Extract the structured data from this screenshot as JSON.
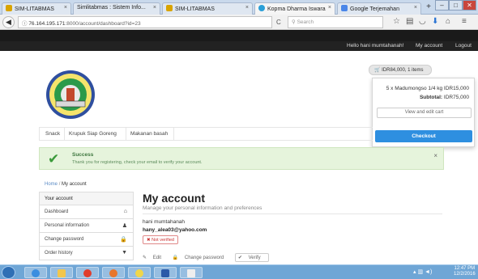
{
  "browser": {
    "tabs": [
      {
        "label": "SIM-LITABMAS",
        "active": false
      },
      {
        "label": "Simlitabmas : Sistem Info...",
        "active": false
      },
      {
        "label": "SIM-LITABMAS",
        "active": false
      },
      {
        "label": "Kopma Dharma Iswara",
        "active": true
      },
      {
        "label": "Google Terjemahan",
        "active": false
      }
    ],
    "url_domain": "76.164.195.171",
    "url_path": ":8000/account/dashboard?id=23",
    "search_placeholder": "Search",
    "close_glyph": "×",
    "newtab_glyph": "+",
    "win_min": "–",
    "win_max": "□",
    "win_close": "✕"
  },
  "header": {
    "greeting": "Hello hani mumtahanah!",
    "my_account": "My account",
    "logout": "Logout"
  },
  "cart": {
    "summary": "IDR84,000, 1 items",
    "line_item": "5 x Madumongso 1/4 kg IDR15,000",
    "subtotal_label": "Subtotal:",
    "subtotal_value": "IDR75,000",
    "view_edit": "View and edit cart",
    "checkout": "Checkout"
  },
  "categories": [
    "Snack",
    "Krupuk Siap Goreng",
    "Makanan basah"
  ],
  "alert": {
    "title": "Success",
    "message": "Thank you for registering, check your email to verify your account.",
    "close": "×"
  },
  "breadcrumb": {
    "home": "Home",
    "separator": "/",
    "current": "My account"
  },
  "sidebar": {
    "items": [
      {
        "label": "Your account",
        "icon": ""
      },
      {
        "label": "Dashboard",
        "icon": "home-icon"
      },
      {
        "label": "Personal information",
        "icon": "user-icon"
      },
      {
        "label": "Change password",
        "icon": "lock-icon"
      },
      {
        "label": "Order history",
        "icon": "filter-icon"
      }
    ]
  },
  "main": {
    "title": "My account",
    "subtitle": "Manage your personal information and preferences",
    "name": "hani mumtahanah",
    "email": "hany_alea03@yahoo.com",
    "status_badge": "Not verified",
    "edit": "Edit",
    "change_password": "Change password",
    "verify": "Verify"
  },
  "taskbar": {
    "time": "12:47 PM",
    "date": "12/2/2016"
  },
  "colors": {
    "accent": "#2e8fe0",
    "success_bg": "#e6f4dc",
    "danger": "#cc3333",
    "topbar": "#222222"
  }
}
